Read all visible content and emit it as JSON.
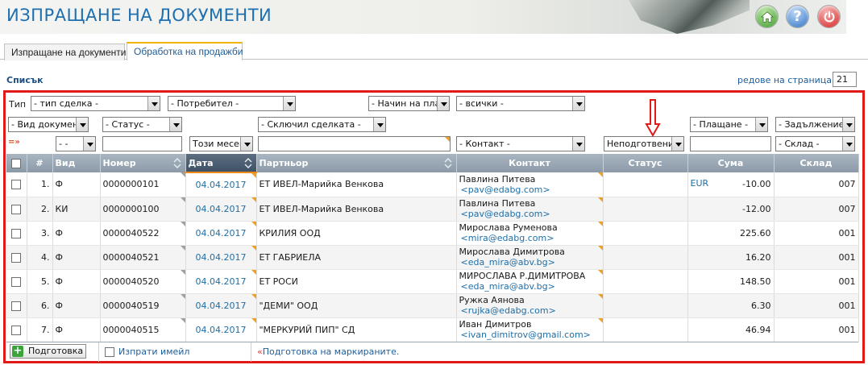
{
  "app": {
    "title": "ИЗПРАЩАНЕ НА ДОКУМЕНТИ",
    "buttons": {
      "home": "home-icon",
      "help": "?",
      "power": "power-icon"
    }
  },
  "tabs": [
    {
      "label": "Изпращане на документи",
      "active": false
    },
    {
      "label": "Обработка на продажби",
      "active": true
    }
  ],
  "list": {
    "label": "Списък",
    "rows_per_page_label": "редове на страница",
    "rows_per_page_value": "21"
  },
  "filters": {
    "type_label": "Тип",
    "deal_type": "- тип сделка -",
    "user": "- Потребител -",
    "payment_method": "- Начин на плаш",
    "all": "- всички -",
    "doc_type": "- Вид документ",
    "status": "- Статус -",
    "concluded_by": "- Сключил сделката -",
    "payment": "- Плащане -",
    "debt": "- Задължение -",
    "reset_icon": "=»",
    "number_op": "- -",
    "period": "Този месец",
    "contact": "- Контакт -",
    "prep_status": "Неподготвени",
    "warehouse": "- Склад -"
  },
  "columns": {
    "num": "#",
    "type": "Вид",
    "number": "Номер",
    "date": "Дата",
    "partner": "Партньор",
    "contact": "Контакт",
    "status": "Статус",
    "amount": "Сума",
    "warehouse": "Склад"
  },
  "rows": [
    {
      "idx": "1.",
      "type": "Ф",
      "number": "0000000101",
      "date": "04.04.2017",
      "partner": "ЕТ ИВЕЛ-Марийка Венкова",
      "contact_name": "Павлина Питева",
      "contact_email": "<pav@edabg.com>",
      "status": "",
      "currency": "EUR",
      "amount": "-10.00",
      "warehouse": "007"
    },
    {
      "idx": "2.",
      "type": "КИ",
      "number": "0000000100",
      "date": "04.04.2017",
      "partner": "ЕТ ИВЕЛ-Марийка Венкова",
      "contact_name": "Павлина Питева",
      "contact_email": "<pav@edabg.com>",
      "status": "",
      "currency": "",
      "amount": "-12.00",
      "warehouse": "007"
    },
    {
      "idx": "3.",
      "type": "Ф",
      "number": "0000040522",
      "date": "04.04.2017",
      "partner": "КРИЛИЯ ООД",
      "contact_name": "Мирослава Руменова",
      "contact_email": "<mira@edabg.com>",
      "status": "",
      "currency": "",
      "amount": "225.60",
      "warehouse": "001"
    },
    {
      "idx": "4.",
      "type": "Ф",
      "number": "0000040521",
      "date": "04.04.2017",
      "partner": "ЕТ ГАБРИЕЛА",
      "contact_name": "Мирослава Димитрова",
      "contact_email": "<eda_mira@abv.bg>",
      "status": "",
      "currency": "",
      "amount": "16.20",
      "warehouse": "001"
    },
    {
      "idx": "5.",
      "type": "Ф",
      "number": "0000040520",
      "date": "04.04.2017",
      "partner": "ЕТ РОСИ",
      "contact_name": "МИРОСЛАВА Р.ДИМИТРОВА",
      "contact_email": "<eda_mira@abv.bg>",
      "status": "",
      "currency": "",
      "amount": "148.50",
      "warehouse": "001"
    },
    {
      "idx": "6.",
      "type": "Ф",
      "number": "0000040519",
      "date": "04.04.2017",
      "partner": "\"ДЕМИ\" ООД",
      "contact_name": "Ружка Аянова",
      "contact_email": "<rujka@edabg.com>",
      "status": "",
      "currency": "",
      "amount": "6.30",
      "warehouse": "001"
    },
    {
      "idx": "7.",
      "type": "Ф",
      "number": "0000040515",
      "date": "04.04.2017",
      "partner": "\"МЕРКУРИЙ ПИП\" СД",
      "contact_name": "Иван Димитров",
      "contact_email": "<ivan_dimitrov@gmail.com>",
      "status": "",
      "currency": "",
      "amount": "46.94",
      "warehouse": "001"
    }
  ],
  "footer": {
    "prepare_button": "Подготовка",
    "send_email": "Изпрати имейл",
    "prepare_marked": "Подготовка на маркираните."
  },
  "colors": {
    "accent": "#1e6fb0",
    "frame": "#e01919",
    "header_bg": "#8c9aa8",
    "date_header": "#3f5166"
  }
}
